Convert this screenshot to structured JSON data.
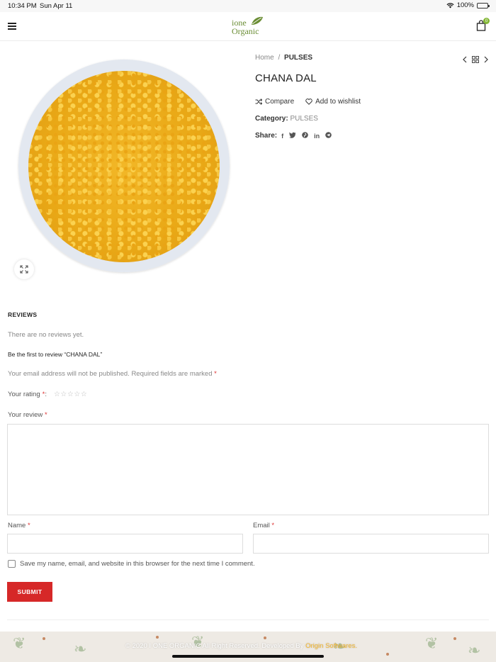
{
  "status_bar": {
    "time": "10:34 PM",
    "date": "Sun Apr 11",
    "battery": "100%"
  },
  "header": {
    "logo_line1": "ione",
    "logo_line2": "Organic",
    "cart_count": "0"
  },
  "breadcrumb": {
    "home": "Home",
    "separator": "/",
    "current": "PULSES"
  },
  "product": {
    "title": "CHANA DAL",
    "compare_label": "Compare",
    "wishlist_label": "Add to wishlist",
    "category_key": "Category:",
    "category_value": "PULSES",
    "share_key": "Share:",
    "share_icons": [
      "facebook-icon",
      "twitter-icon",
      "pinterest-icon",
      "linkedin-icon",
      "telegram-icon"
    ]
  },
  "reviews": {
    "heading": "REVIEWS",
    "no_reviews": "There are no reviews yet.",
    "be_first": "Be the first to review “CHANA DAL”",
    "notes": "Your email address will not be published. Required fields are marked",
    "required_mark": "*",
    "rating_label": "Your rating",
    "rating_suffix": ":",
    "stars": "☆☆☆☆☆",
    "review_label": "Your review",
    "name_label": "Name",
    "email_label": "Email",
    "save_label": "Save my name, email, and website in this browser for the next time I comment.",
    "submit_label": "SUBMIT"
  },
  "footer": {
    "copyright": "© 2020 I ONE ORGANIC All Right Reserved. Developed By",
    "developer": "Origin Softwares.",
    "brand_color": "#f5b82e"
  },
  "colors": {
    "accent_green": "#83b735",
    "submit_red": "#d62828",
    "required_red": "#dd3333"
  }
}
